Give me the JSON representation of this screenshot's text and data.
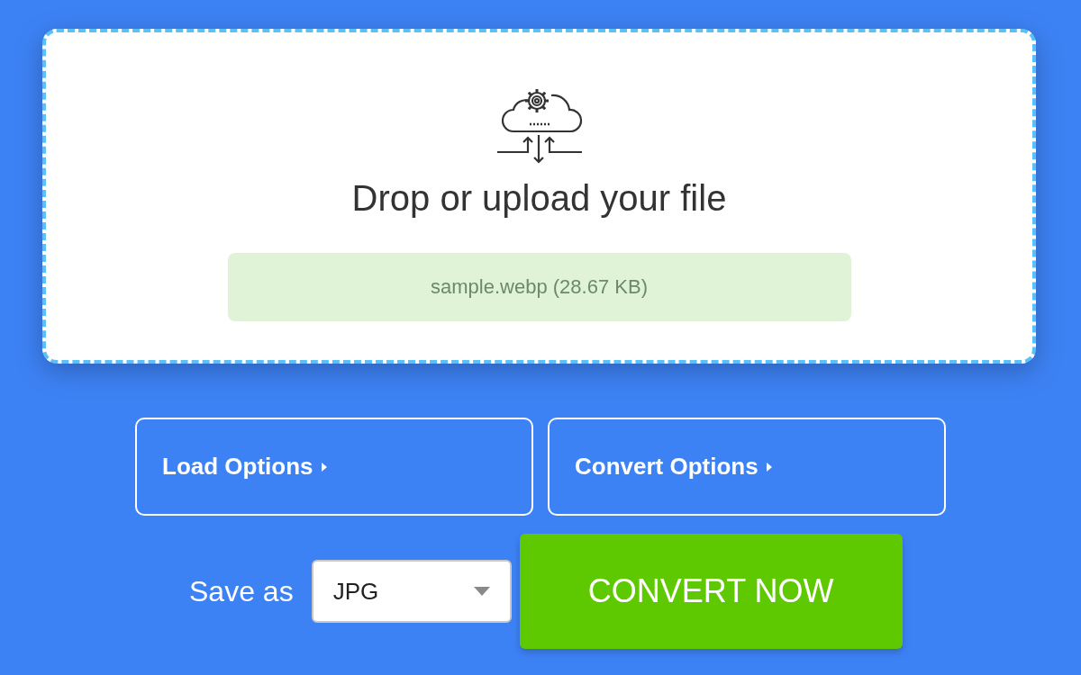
{
  "upload": {
    "title": "Drop or upload your file",
    "file": "sample.webp (28.67 KB)"
  },
  "options": [
    {
      "label": "Load Options",
      "expanded": false
    },
    {
      "label": "Convert Options",
      "expanded": false
    }
  ],
  "save_as": {
    "label": "Save as",
    "value": "JPG"
  },
  "convert_button": "CONVERT NOW"
}
